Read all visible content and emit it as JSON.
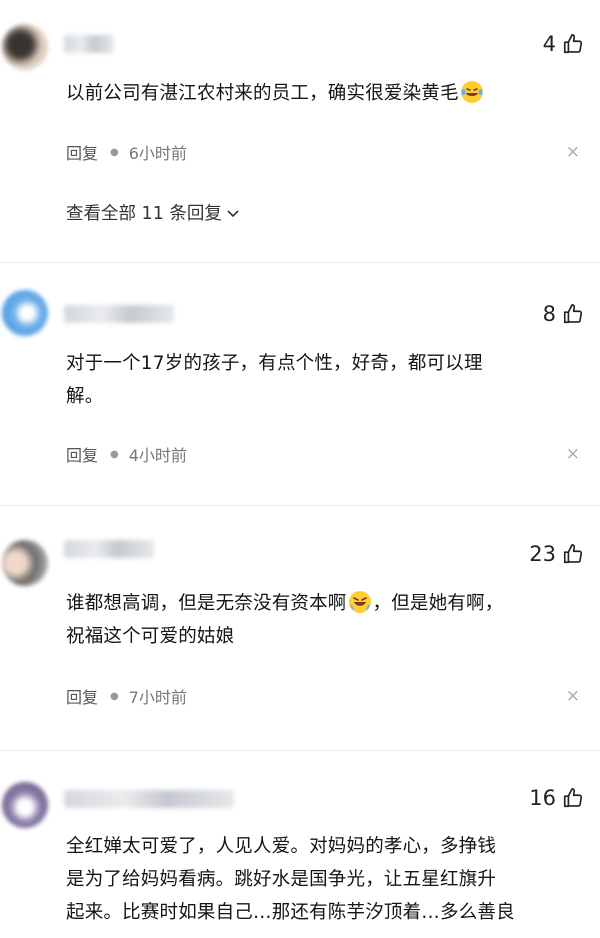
{
  "comments": [
    {
      "likes": "4",
      "text": "以前公司有湛江农村来的员工，确实很爱染黄毛",
      "reply_label": "回复",
      "time": "6小时前",
      "close_glyph": "×",
      "view_all": "查看全部 11 条回复"
    },
    {
      "likes": "8",
      "text_line1": "对于一个17岁的孩子，有点个性，好奇，都可以理",
      "text_line2": "解。",
      "reply_label": "回复",
      "time": "4小时前",
      "close_glyph": "×"
    },
    {
      "likes": "23",
      "text_line1a": "谁都想高调，但是无奈没有资本啊",
      "text_line1b": "，但是她有啊，",
      "text_line2": "祝福这个可爱的姑娘",
      "reply_label": "回复",
      "time": "7小时前",
      "close_glyph": "×"
    },
    {
      "likes": "16",
      "text_line1": "全红婵太可爱了，人见人爱。对妈妈的孝心，多挣钱",
      "text_line2": "是为了给妈妈看病。跳好水是国争光，让五星红旗升",
      "text_line3": "起来。比赛时如果自己…那还有陈芋汐顶着…多么善良"
    }
  ],
  "icons": {
    "like": "thumbs-up-icon",
    "close": "close-icon",
    "chevron": "chevron-down-icon",
    "emoji_laugh": "laughing-tears-emoji",
    "emoji_cry": "crying-laughing-emoji"
  },
  "colors": {
    "text": "#151515",
    "meta": "#777777",
    "divider": "#ececec"
  }
}
